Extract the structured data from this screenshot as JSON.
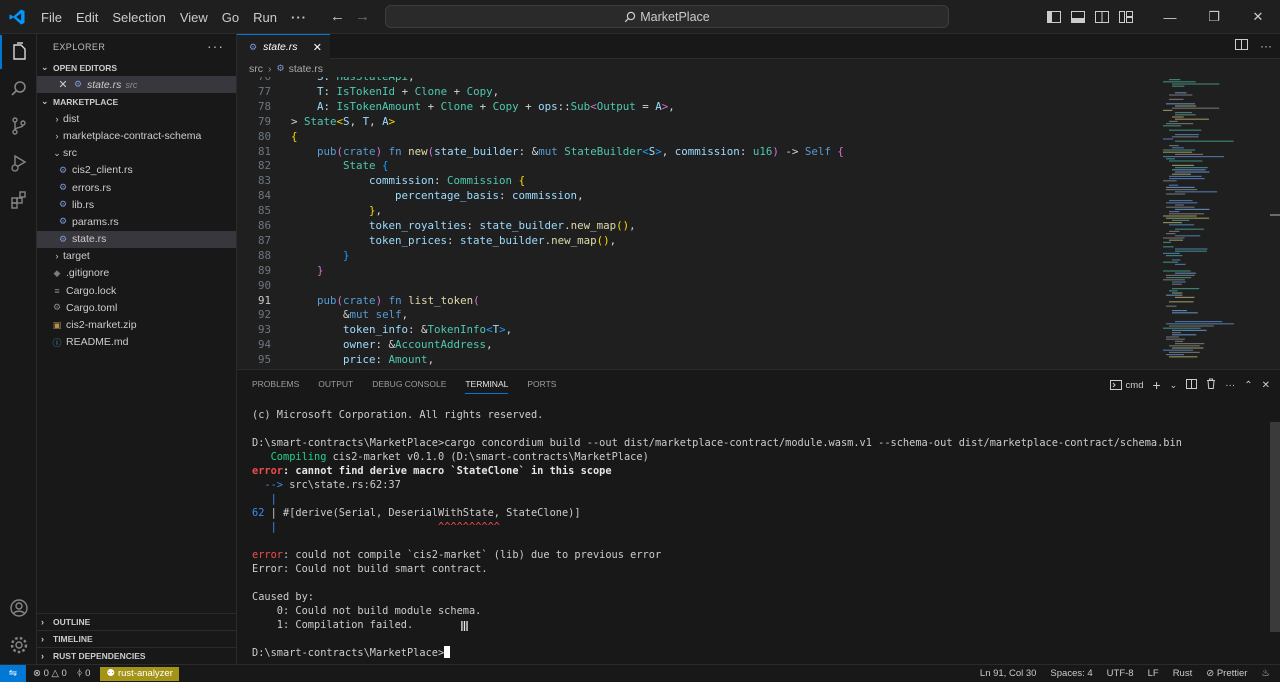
{
  "titlebar": {
    "menus": [
      "File",
      "Edit",
      "Selection",
      "View",
      "Go",
      "Run"
    ],
    "more": "···",
    "search_text": "MarketPlace"
  },
  "sidebar": {
    "title": "EXPLORER",
    "open_editors_label": "OPEN EDITORS",
    "open_editor_file": "state.rs",
    "open_editor_dir": "src",
    "project_label": "MARKETPLACE",
    "tree": [
      {
        "label": "dist",
        "kind": "folder",
        "depth": 1
      },
      {
        "label": "marketplace-contract-schema",
        "kind": "folder",
        "depth": 1
      },
      {
        "label": "src",
        "kind": "folder-open",
        "depth": 1
      },
      {
        "label": "cis2_client.rs",
        "kind": "rs",
        "depth": 2
      },
      {
        "label": "errors.rs",
        "kind": "rs",
        "depth": 2
      },
      {
        "label": "lib.rs",
        "kind": "rs",
        "depth": 2
      },
      {
        "label": "params.rs",
        "kind": "rs",
        "depth": 2
      },
      {
        "label": "state.rs",
        "kind": "rs",
        "depth": 2,
        "selected": true
      },
      {
        "label": "target",
        "kind": "folder",
        "depth": 1
      },
      {
        "label": ".gitignore",
        "kind": "git",
        "depth": 1
      },
      {
        "label": "Cargo.lock",
        "kind": "lock",
        "depth": 1
      },
      {
        "label": "Cargo.toml",
        "kind": "toml",
        "depth": 1
      },
      {
        "label": "cis2-market.zip",
        "kind": "zip",
        "depth": 1
      },
      {
        "label": "README.md",
        "kind": "md",
        "depth": 1
      }
    ],
    "bottom_sections": [
      "OUTLINE",
      "TIMELINE",
      "RUST DEPENDENCIES"
    ]
  },
  "editor": {
    "tab_label": "state.rs",
    "breadcrumb": [
      "src",
      "state.rs"
    ],
    "first_line": 76,
    "current_line": 91
  },
  "panel": {
    "tabs": [
      "PROBLEMS",
      "OUTPUT",
      "DEBUG CONSOLE",
      "TERMINAL",
      "PORTS"
    ],
    "active_tab": "TERMINAL",
    "shell": "cmd",
    "terminal": {
      "copyright": "(c) Microsoft Corporation. All rights reserved.",
      "prompt1": "D:\\smart-contracts\\MarketPlace>",
      "command": "cargo concordium build --out dist/marketplace-contract/module.wasm.v1 --schema-out dist/marketplace-contract/schema.bin",
      "compiling_kw": "Compiling",
      "compiling_rest": " cis2-market v0.1.0 (D:\\smart-contracts\\MarketPlace)",
      "error_kw": "error",
      "error1_msg": ": cannot find derive macro `StateClone` in this scope",
      "arrow": "  --> ",
      "location": "src\\state.rs:62:37",
      "pipe": "   |",
      "line_no": "62",
      "snippet": " | #[derive(Serial, DeserialWithState, StateClone)]",
      "carets": "^^^^^^^^^^",
      "error2_msg": ": could not compile `cis2-market` (lib) due to previous error",
      "error3": "Error: Could not build smart contract.",
      "caused_by": "Caused by:",
      "cause0": "    0: Could not build module schema.",
      "cause1": "    1: Compilation failed.",
      "prompt2": "D:\\smart-contracts\\MarketPlace>"
    }
  },
  "statusbar": {
    "errors": "0",
    "warnings": "0",
    "ports": "0",
    "rust_analyzer": "rust-analyzer",
    "position": "Ln 91, Col 30",
    "spaces": "Spaces: 4",
    "encoding": "UTF-8",
    "eol": "LF",
    "language": "Rust",
    "prettier": "Prettier"
  }
}
